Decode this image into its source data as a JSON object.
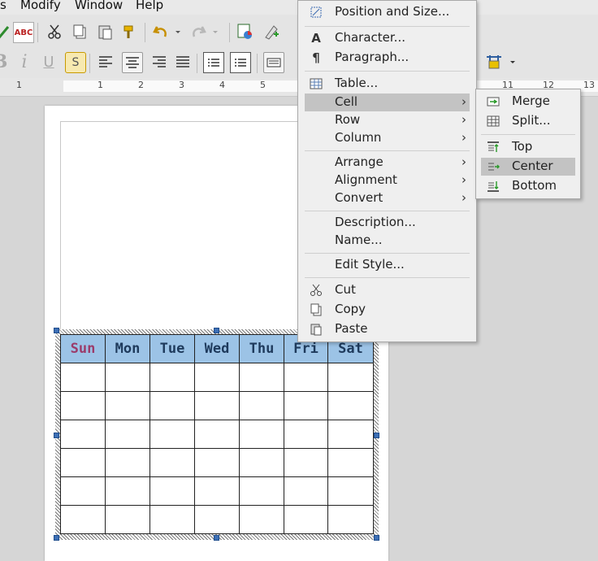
{
  "menubar": {
    "items": [
      "s",
      "Modify",
      "Window",
      "Help"
    ]
  },
  "ruler": {
    "ticks": [
      "1",
      "1",
      "2",
      "3",
      "4",
      "5",
      "11",
      "12",
      "13"
    ]
  },
  "calendar": {
    "headers": [
      "Sun",
      "Mon",
      "Tue",
      "Wed",
      "Thu",
      "Fri",
      "Sat"
    ],
    "rows": 6
  },
  "context_menu": {
    "items": [
      {
        "label": "Position and Size...",
        "icon": "position-size-icon"
      },
      {
        "label": "Character...",
        "icon": "character-icon"
      },
      {
        "label": "Paragraph...",
        "icon": "paragraph-icon"
      },
      {
        "label": "Table...",
        "icon": "table-icon"
      },
      {
        "label": "Cell",
        "submenu": true,
        "highlighted": true
      },
      {
        "label": "Row",
        "submenu": true
      },
      {
        "label": "Column",
        "submenu": true
      },
      {
        "label": "Arrange",
        "submenu": true
      },
      {
        "label": "Alignment",
        "submenu": true
      },
      {
        "label": "Convert",
        "submenu": true
      },
      {
        "label": "Description..."
      },
      {
        "label": "Name..."
      },
      {
        "label": "Edit Style..."
      },
      {
        "label": "Cut",
        "icon": "scissors-icon"
      },
      {
        "label": "Copy",
        "icon": "copy-icon"
      },
      {
        "label": "Paste",
        "icon": "paste-icon"
      }
    ],
    "submenu_arrow": "›"
  },
  "cell_submenu": {
    "items": [
      {
        "label": "Merge",
        "icon": "merge-cells-icon"
      },
      {
        "label": "Split...",
        "icon": "split-cells-icon"
      },
      {
        "label": "Top",
        "icon": "align-top-icon"
      },
      {
        "label": "Center",
        "icon": "align-center-icon",
        "highlighted": true
      },
      {
        "label": "Bottom",
        "icon": "align-bottom-icon"
      }
    ]
  },
  "toolbar": {
    "spellcheck_label": "ABC"
  },
  "colors": {
    "header_fill": "#9cc3e6",
    "header_text": "#1e3a5c",
    "sunday_text": "#9b3b6a",
    "menu_highlight": "#c3c3c3"
  }
}
